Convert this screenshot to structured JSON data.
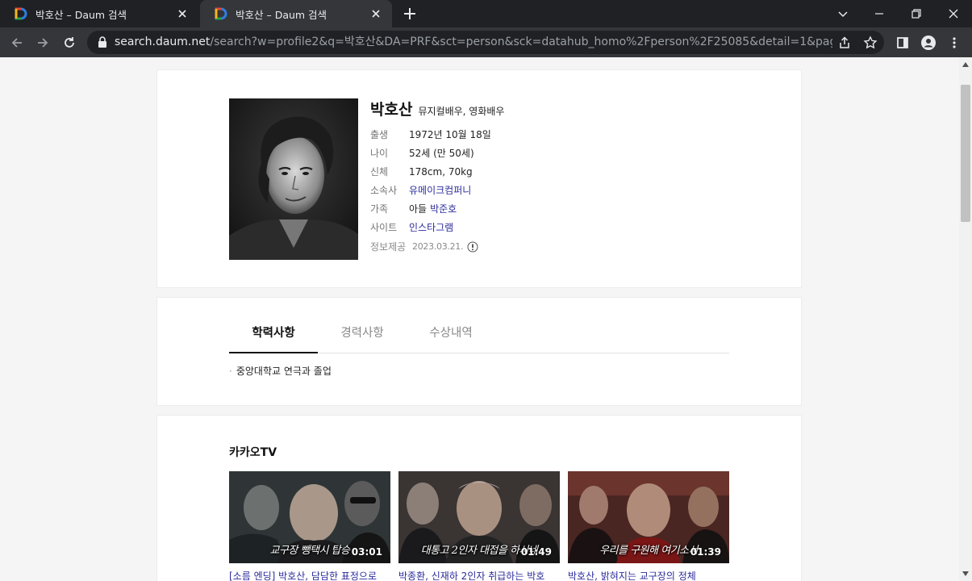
{
  "browser": {
    "tabs": [
      {
        "title": "박호산 – Daum 검색",
        "active": false
      },
      {
        "title": "박호산 – Daum 검색",
        "active": true
      }
    ],
    "url_host": "search.daum.net",
    "url_path": "/search?w=profile2&q=박호산&DA=PRF&sct=person&sck=datahub_homo%2Fperson%2F25085&detail=1&page=1&size..."
  },
  "profile": {
    "name": "박호산",
    "job": "뮤지컬배우, 영화배우",
    "fields": [
      {
        "label": "출생",
        "value": "1972년 10월 18일"
      },
      {
        "label": "나이",
        "value": "52세 (만 50세)"
      },
      {
        "label": "신체",
        "value": "178cm, 70kg"
      },
      {
        "label": "소속사",
        "value": "유메이크컴퍼니"
      },
      {
        "label": "가족",
        "relation": "아들",
        "value": "박준호"
      },
      {
        "label": "사이트",
        "value": "인스타그램"
      }
    ],
    "source_label": "정보제공",
    "source_date": "2023.03.21."
  },
  "career": {
    "tabs": [
      "학력사항",
      "경력사항",
      "수상내역"
    ],
    "active_tab": "학력사항",
    "education": [
      "중앙대학교 연극과 졸업"
    ]
  },
  "kakaotv": {
    "title": "카카오TV",
    "videos": [
      {
        "caption": "교구장 뺑택시 탑승",
        "duration": "03:01",
        "title": "[소름 엔딩] 박호산, 담담한 표정으로"
      },
      {
        "caption": "대통고 2인자 대접을 하시네",
        "duration": "01:49",
        "title": "박종환, 신재하 2인자 취급하는 박호"
      },
      {
        "caption": "우리를 구원해 여기소서",
        "duration": "01:39",
        "title": "박호산, 밝혀지는 교구장의 정체"
      }
    ]
  },
  "colors": {
    "chrome_dark": "#202124",
    "chrome_toolbar": "#35363a",
    "link": "#2c2c9c",
    "daum_favicon": [
      "#e8452e",
      "#f6b51e",
      "#21a049",
      "#2276e2"
    ]
  }
}
